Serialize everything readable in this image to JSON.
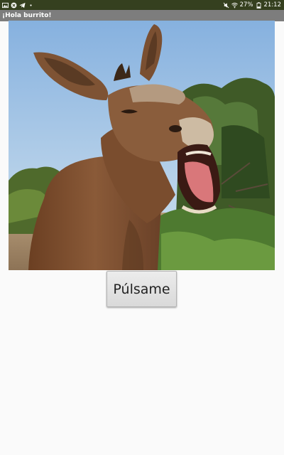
{
  "status_bar": {
    "battery": "27%",
    "time": "21:12",
    "left_icons": [
      "notification-gallery-icon",
      "notification-blocked-icon",
      "telegram-icon",
      "more-notifications-dot"
    ],
    "right_icons": [
      "mute-icon",
      "wifi-icon",
      "battery-icon"
    ]
  },
  "app": {
    "title": "¡Hola burrito!"
  },
  "main": {
    "image_subject": "donkey-braying-photo",
    "button_label": "Púlsame"
  },
  "colors": {
    "status_bar_bg": "#35401f",
    "action_bar_bg": "#7d7d7d",
    "page_bg": "#fafafa",
    "button_bg": "#e3e3e3"
  }
}
